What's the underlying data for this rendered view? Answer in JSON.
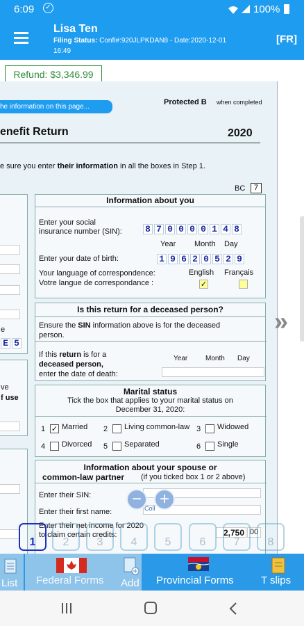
{
  "status_bar": {
    "time": "6:09",
    "battery": "100%"
  },
  "app_bar": {
    "name": "Lisa Ten",
    "filing_status_label": "Filing Status:",
    "confirmation_label": "Confi#:",
    "confirmation": "920JLPKDAN8",
    "date_label": "Date:",
    "date": "2020-12-01",
    "time": "16:49",
    "lang_button": "[FR]"
  },
  "refund": "Refund: $3,346.99",
  "form": {
    "info_link": "he information on this page...",
    "protected": "Protected B",
    "when_completed": "when completed",
    "title": "enefit Return",
    "year": "2020",
    "intro_pre": "e sure you enter ",
    "intro_bold": "their information",
    "intro_post": " in all the boxes in Step 1.",
    "province_code": "BC",
    "province_box": "7",
    "info_you": {
      "title": "Information about you",
      "sin_l1": "Enter your social",
      "sin_l2": "insurance number (SIN):",
      "sin_digits": [
        "8",
        "7",
        "0",
        "0",
        "0",
        "0",
        "1",
        "4",
        "8"
      ],
      "col_year": "Year",
      "col_month": "Month",
      "col_day": "Day",
      "dob_label": "Enter your date of birth:",
      "dob_digits": [
        "1",
        "9",
        "6",
        "2",
        "0",
        "5",
        "2",
        "9"
      ],
      "lang_en_label": "Your language of correspondence:",
      "lang_fr_label": "Votre langue de correspondance :",
      "english": "English",
      "francais": "Français",
      "english_mark": "✓"
    },
    "deceased": {
      "title": "Is this return for a deceased person?",
      "l1_pre": "Ensure the ",
      "l1_bold": "SIN",
      "l1_post": " information above is for the deceased",
      "l2": "person.",
      "q1_pre": "If this ",
      "q1_bold": "return",
      "q1_post": " is for a",
      "q2": "deceased person,",
      "q3": "enter the date of death:",
      "year": "Year",
      "month": "Month",
      "day": "Day"
    },
    "marital": {
      "title": "Marital status",
      "sub1": "Tick the box that applies to your marital status on",
      "sub2": "December 31, 2020:",
      "opts": [
        {
          "n": "1",
          "label": "Married",
          "mark": "✓"
        },
        {
          "n": "2",
          "label": "Living common-law",
          "mark": ""
        },
        {
          "n": "3",
          "label": "Widowed",
          "mark": ""
        },
        {
          "n": "4",
          "label": "Divorced",
          "mark": ""
        },
        {
          "n": "5",
          "label": "Separated",
          "mark": ""
        },
        {
          "n": "6",
          "label": "Single",
          "mark": ""
        }
      ]
    },
    "spouse": {
      "title1": "Information about your spouse or",
      "title2": "common-law partner",
      "title_note": "(if you ticked box 1 or 2 above)",
      "sin_label": "Enter their SIN:",
      "first_name_label": "Enter their first name:",
      "net_income_l1": "Enter their net income for 2020",
      "net_income_l2": "to claim certain credits:",
      "net_income_value": "2,750",
      "net_income_cents": "00"
    },
    "left_frag": {
      "e": "e",
      "ve": "ve",
      "of_use": "f use",
      "digit_e": "E",
      "digit_5": "5"
    }
  },
  "zoom": {
    "minus": "−",
    "plus": "+",
    "label": "Coll"
  },
  "pages": [
    "1",
    "2",
    "3",
    "4",
    "5",
    "6",
    "7",
    "8"
  ],
  "bottom_tabs": {
    "list": "List",
    "federal": "Federal Forms",
    "add": "Add",
    "provincial": "Provincial Forms",
    "tslips": "T slips"
  },
  "colors": {
    "accent": "#1e9cf0",
    "refund_green": "#2e8b3a"
  }
}
